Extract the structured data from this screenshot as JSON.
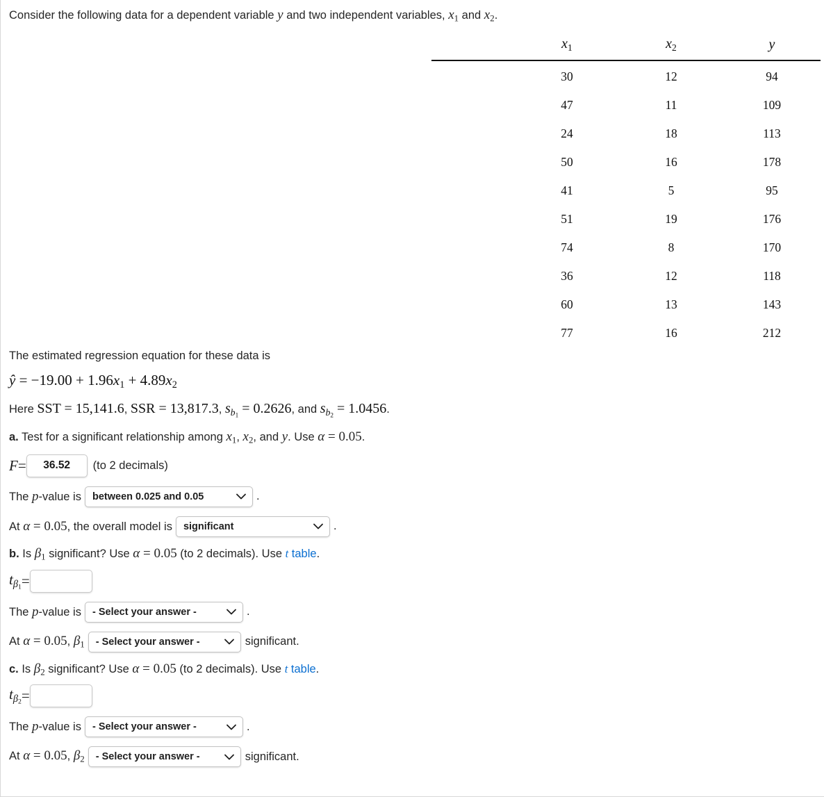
{
  "intro": {
    "text_before": "Consider the following data for a dependent variable ",
    "var_y": "y",
    "text_mid": " and two independent variables, ",
    "var_x1": "x",
    "sub1": "1",
    "text_and": " and ",
    "var_x2": "x",
    "sub2": "2",
    "text_end": "."
  },
  "table": {
    "headers": [
      "x1",
      "x2",
      "y"
    ],
    "header_base": [
      "x",
      "x",
      "y"
    ],
    "header_subs": [
      "1",
      "2",
      ""
    ],
    "rows": [
      [
        "30",
        "12",
        "94"
      ],
      [
        "47",
        "11",
        "109"
      ],
      [
        "24",
        "18",
        "113"
      ],
      [
        "50",
        "16",
        "178"
      ],
      [
        "41",
        "5",
        "95"
      ],
      [
        "51",
        "19",
        "176"
      ],
      [
        "74",
        "8",
        "170"
      ],
      [
        "36",
        "12",
        "118"
      ],
      [
        "60",
        "13",
        "143"
      ],
      [
        "77",
        "16",
        "212"
      ]
    ]
  },
  "regression": {
    "intro_line": "The estimated regression equation for these data is",
    "equation": "ŷ = −19.00 + 1.96x₁ + 4.89x₂",
    "equation_parts": {
      "yhat": "ŷ",
      "eq": " = ",
      "intercept": "−19.00",
      "plus1": " + ",
      "b1": "1.96",
      "x1": "x",
      "sub1": "1",
      "plus2": " + ",
      "b2": "4.89",
      "x2": "x",
      "sub2": "2"
    },
    "here": {
      "word_here": "Here ",
      "sst_label": "SST",
      "sst_value": "15,141.6",
      "ssr_label": "SSR",
      "ssr_value": "13,817.3",
      "sb1_label": "s",
      "sb1_sub": "b",
      "sb1_subsub": "1",
      "sb1_value": "0.2626",
      "and_word": ", and ",
      "sb2_label": "s",
      "sb2_sub": "b",
      "sb2_subsub": "2",
      "sb2_value": "1.0456",
      "equals": " = ",
      "comma": ", ",
      "period": "."
    }
  },
  "part_a": {
    "marker": "a.",
    "prompt_1": " Test for a significant relationship among ",
    "x1": "x",
    "x1_sub": "1",
    "comma_1": ", ",
    "x2": "x",
    "x2_sub": "2",
    "comma_and": ", and ",
    "y": "y",
    "prompt_2": ". Use ",
    "alpha": "α",
    "alpha_eq": " = ",
    "alpha_value": "0.05",
    "period": ".",
    "f_label": "F",
    "f_eq": " = ",
    "f_value": "36.52",
    "f_hint": "(to 2 decimals)",
    "pvalue_label_1": "The ",
    "pvalue_label_p": "p",
    "pvalue_label_2": "-value is",
    "pvalue_select": "between 0.025 and 0.05",
    "model_line_at": "At ",
    "model_line_mid": ", the overall model is",
    "model_select": "significant"
  },
  "part_b": {
    "marker": "b.",
    "prompt_1": " Is ",
    "beta": "β",
    "beta_sub": "1",
    "prompt_2": " significant? Use ",
    "alpha": "α",
    "alpha_eq": " = ",
    "alpha_value": "0.05",
    "prompt_3": " (to 2 decimals). Use ",
    "link_t": "t",
    "link_table": " table",
    "period": ".",
    "t_label": "t",
    "t_sub_beta": "β",
    "t_sub_num": "1",
    "t_eq": " = ",
    "t_value": "",
    "t_placeholder": "",
    "pvalue_label_1": "The ",
    "pvalue_label_p": "p",
    "pvalue_label_2": "-value is",
    "pvalue_select": "- Select your answer -",
    "conclusion_at": "At ",
    "conclusion_mid": ", ",
    "conclusion_select": "- Select your answer -",
    "conclusion_tail": "significant."
  },
  "part_c": {
    "marker": "c.",
    "prompt_1": " Is ",
    "beta": "β",
    "beta_sub": "2",
    "prompt_2": " significant? Use ",
    "alpha": "α",
    "alpha_eq": " = ",
    "alpha_value": "0.05",
    "prompt_3": " (to 2 decimals). Use ",
    "link_t": "t",
    "link_table": " table",
    "period": ".",
    "t_label": "t",
    "t_sub_beta": "β",
    "t_sub_num": "2",
    "t_eq": " = ",
    "t_value": "",
    "pvalue_label_1": "The ",
    "pvalue_label_p": "p",
    "pvalue_label_2": "-value is",
    "pvalue_select": "- Select your answer -",
    "conclusion_at": "At ",
    "conclusion_mid": ", ",
    "conclusion_select": "- Select your answer -",
    "conclusion_tail": "significant."
  },
  "colors": {
    "link": "#0b6fd1",
    "text": "#262626",
    "rule": "#111111"
  }
}
